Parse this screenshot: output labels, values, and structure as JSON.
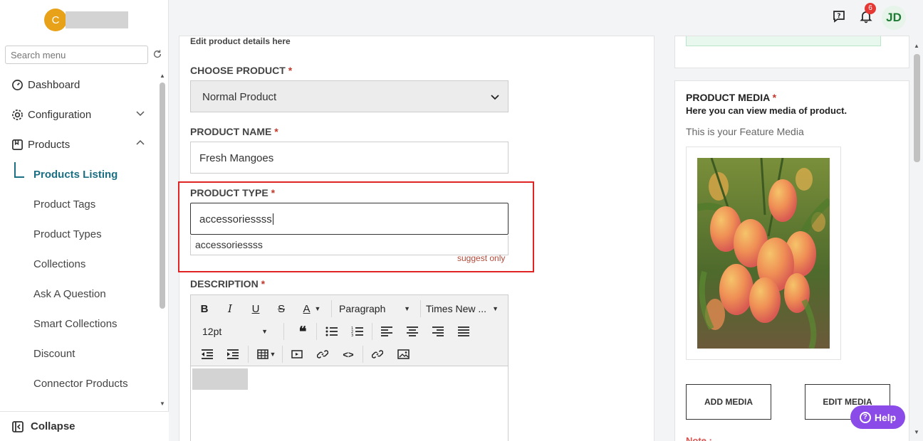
{
  "sidebar": {
    "logo_letter": "C",
    "search_placeholder": "Search menu",
    "items": [
      {
        "label": "Dashboard"
      },
      {
        "label": "Configuration"
      },
      {
        "label": "Products"
      }
    ],
    "sub_items": [
      {
        "label": "Products Listing"
      },
      {
        "label": "Product Tags"
      },
      {
        "label": "Product Types"
      },
      {
        "label": "Collections"
      },
      {
        "label": "Ask A Question"
      },
      {
        "label": "Smart Collections"
      },
      {
        "label": "Discount"
      },
      {
        "label": "Connector Products"
      }
    ],
    "collapse_label": "Collapse"
  },
  "topbar": {
    "notification_count": "6",
    "user_initials": "JD"
  },
  "form": {
    "subtitle": "Edit product details here",
    "choose_product": {
      "label": "CHOOSE PRODUCT",
      "value": "Normal Product"
    },
    "product_name": {
      "label": "PRODUCT NAME",
      "value": "Fresh Mangoes"
    },
    "product_type": {
      "label": "PRODUCT TYPE",
      "value": "accessoriessss",
      "suggestion": "accessoriessss",
      "hint": "suggest only"
    },
    "description": {
      "label": "DESCRIPTION"
    },
    "required_mark": "*"
  },
  "editor": {
    "block_format": "Paragraph",
    "font_family": "Times New ...",
    "font_size": "12pt"
  },
  "media": {
    "title": "PRODUCT MEDIA",
    "subtitle": "Here you can view media of product.",
    "feature_label": "This is your Feature Media",
    "add_button": "ADD MEDIA",
    "edit_button": "EDIT MEDIA",
    "note": "Note :"
  },
  "help": {
    "label": "Help"
  },
  "colors": {
    "accent": "#1b6f82",
    "required": "#c0392b",
    "highlight_border": "#e02424",
    "help_button": "#8b4be8",
    "logo": "#e8a21a"
  }
}
